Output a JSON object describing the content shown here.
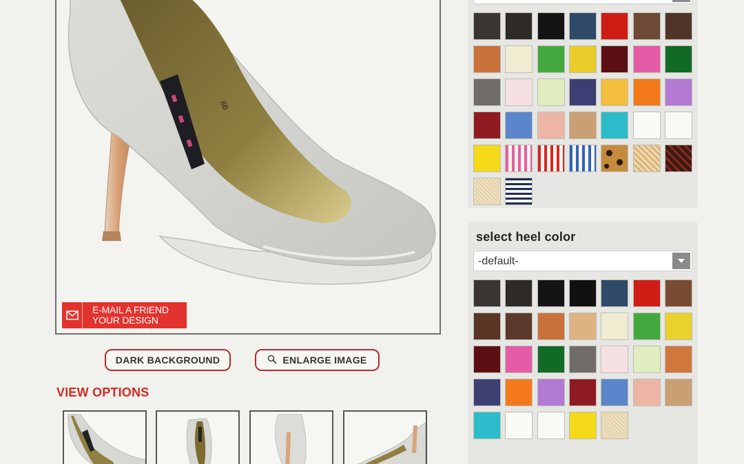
{
  "product": {
    "email_label_line1": "E-MAIL A FRIEND",
    "email_label_line2": "YOUR DESIGN",
    "dark_background_label": "DARK BACKGROUND",
    "enlarge_label": "ENLARGE IMAGE",
    "view_options_label": "VIEW OPTIONS",
    "shoe_size_mark": "8B"
  },
  "upper_panel": {
    "swatches": [
      {
        "color": "#3a3530"
      },
      {
        "color": "#2e2a27"
      },
      {
        "color": "#141414"
      },
      {
        "color": "#2f4a66"
      },
      {
        "color": "#cf1d16"
      },
      {
        "color": "#6d4a35"
      },
      {
        "color": "#4f3427"
      },
      {
        "color": "#c9713a"
      },
      {
        "color": "#f0ecd2"
      },
      {
        "color": "#43a93e"
      },
      {
        "color": "#e9cd2a"
      },
      {
        "color": "#5c0f12"
      },
      {
        "color": "#e45ca6"
      },
      {
        "color": "#116a25"
      },
      {
        "color": "#6f6c69"
      },
      {
        "color": "#f6e1e2"
      },
      {
        "color": "#e0edbe"
      },
      {
        "color": "#3d3f73"
      },
      {
        "color": "#f4bf3e"
      },
      {
        "color": "#f4791b"
      },
      {
        "color": "#b27ad3"
      },
      {
        "color": "#8e1b22"
      },
      {
        "color": "#5c86cb"
      },
      {
        "color": "#edb5a6"
      },
      {
        "color": "#c99f74"
      },
      {
        "color": "#2cbcc9"
      },
      {
        "color": "#fbfbf6"
      },
      {
        "color": "#f9f9f4"
      },
      {
        "color": "#f4da18"
      },
      {
        "color": "pattern-pink-stripes"
      },
      {
        "color": "pattern-red-stripes"
      },
      {
        "color": "pattern-blue-stripes"
      },
      {
        "color": "pattern-leopard"
      },
      {
        "color": "pattern-straw"
      },
      {
        "color": "pattern-croc"
      },
      {
        "color": "pattern-linen"
      },
      {
        "color": "pattern-navy-stripes"
      }
    ]
  },
  "heel_panel": {
    "title": "select heel color",
    "dropdown_value": "-default-",
    "swatches": [
      {
        "color": "#3a3530"
      },
      {
        "color": "#2e2a27"
      },
      {
        "color": "#141414"
      },
      {
        "color": "#111111"
      },
      {
        "color": "#2f4a66"
      },
      {
        "color": "#cf1d16"
      },
      {
        "color": "#7a4b33"
      },
      {
        "color": "#5a3526"
      },
      {
        "color": "#5b392d"
      },
      {
        "color": "#c9713a"
      },
      {
        "color": "#ddb381"
      },
      {
        "color": "#f0ecd2"
      },
      {
        "color": "#43a93e"
      },
      {
        "color": "#ebd12c"
      },
      {
        "color": "#5c0f12"
      },
      {
        "color": "#e45ca6"
      },
      {
        "color": "#116a25"
      },
      {
        "color": "#6f6c69"
      },
      {
        "color": "#f6e1e2"
      },
      {
        "color": "#e0edbe"
      },
      {
        "color": "#d0773e"
      },
      {
        "color": "#3d3f73"
      },
      {
        "color": "#f4791b"
      },
      {
        "color": "#b27ad3"
      },
      {
        "color": "#8e1b22"
      },
      {
        "color": "#5c86cb"
      },
      {
        "color": "#edb5a6"
      },
      {
        "color": "#c99f74"
      },
      {
        "color": "#2cbcc9"
      },
      {
        "color": "#fbfbf6"
      },
      {
        "color": "#f9f9f4"
      },
      {
        "color": "#f4da18"
      },
      {
        "color": "pattern-linen"
      }
    ]
  },
  "colors": {
    "accent_red": "#d32a23",
    "frame_border": "#6f6f6f",
    "panel_bg": "#e6e6e2"
  },
  "icons": {
    "email": "envelope-icon",
    "enlarge": "magnifier-icon",
    "dropdown": "chevron-down-icon"
  }
}
